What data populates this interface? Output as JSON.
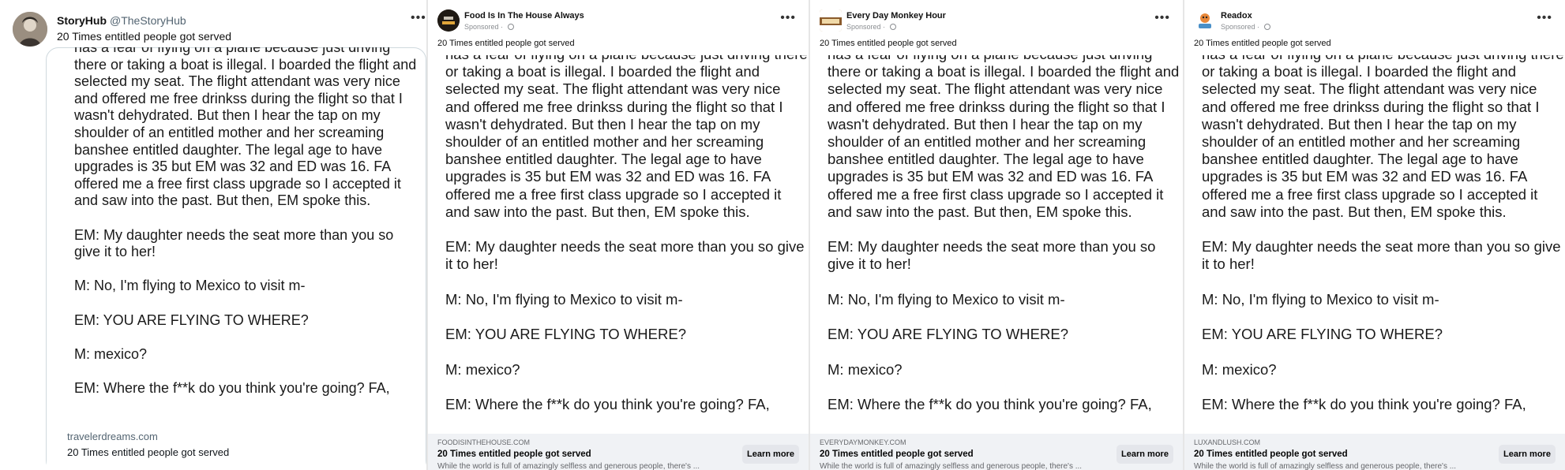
{
  "story_text": "has a fear of flying on a plane because just driving there or taking a boat is illegal. I boarded the flight and selected my seat. The flight attendant was very nice and offered me free drinkss during the flight so that I wasn't dehydrated. But then I hear the tap on my shoulder of an entitled mother and her screaming banshee entitled daughter. The legal age to have upgrades is 35 but EM was 32 and ED was 16. FA offered me a free first class upgrade so I accepted it and saw into the past. But then, EM spoke this.\n\nEM: My daughter needs the seat more than you so give it to her!\n\nM: No, I'm flying to Mexico to visit m-\n\nEM: YOU ARE FLYING TO WHERE?\n\nM: mexico?\n\nEM: Where the f**k do you think you're going? FA,",
  "panels": [
    {
      "name": "StoryHub",
      "handle": "@TheStoryHub",
      "caption": "20 Times entitled people got served",
      "footer": {
        "domain": "travelerdreams.com",
        "title": "20 Times entitled people got served"
      }
    },
    {
      "name": "Food Is In The House Always",
      "sponsored": "Sponsored · ",
      "caption": "20 Times entitled people got served",
      "footer": {
        "domain": "FOODISINTHEHOUSE.COM",
        "title": "20 Times entitled people got served",
        "desc": "While the world is full of amazingly selfless and generous people, there's ...",
        "button": "Learn more"
      }
    },
    {
      "name": "Every Day Monkey Hour",
      "sponsored": "Sponsored · ",
      "caption": "20 Times entitled people got served",
      "footer": {
        "domain": "EVERYDAYMONKEY.COM",
        "title": "20 Times entitled people got served",
        "desc": "While the world is full of amazingly selfless and generous people, there's ...",
        "button": "Learn more"
      }
    },
    {
      "name": "Readox",
      "sponsored": "Sponsored · ",
      "caption": "20 Times entitled people got served",
      "footer": {
        "domain": "LUXANDLUSH.COM",
        "title": "20 Times entitled people got served",
        "desc": "While the world is full of amazingly selfless and generous people, there's ...",
        "button": "Learn more"
      }
    }
  ],
  "icons": {
    "menu": "more-horizontal-icon",
    "audience": "globe-icon"
  }
}
